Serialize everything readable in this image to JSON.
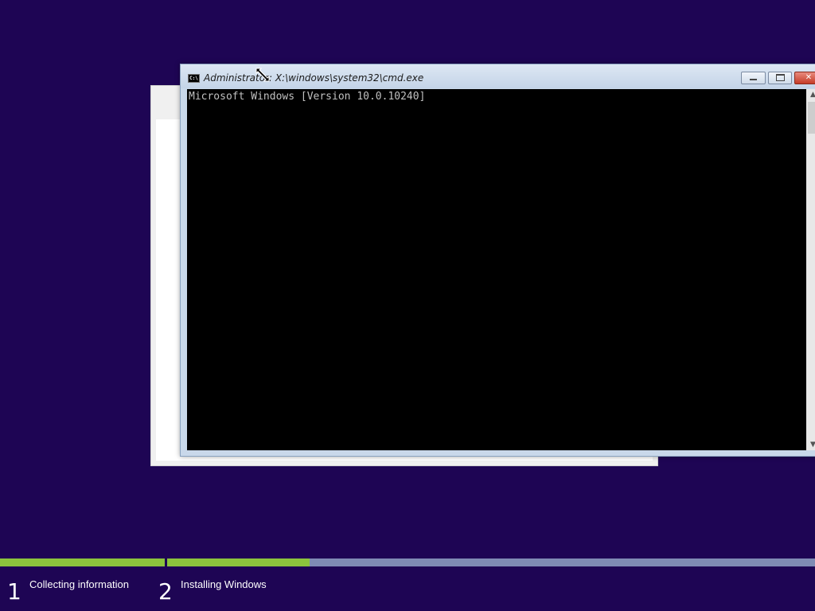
{
  "cmd_window": {
    "title": "Administrator: X:\\windows\\system32\\cmd.exe",
    "icon": "cmd-app-icon",
    "icon_text": "C:\\",
    "console_output": "Microsoft Windows [Version 10.0.10240]",
    "buttons": {
      "minimize": "minimize-icon",
      "maximize": "maximize-icon",
      "close": "close-icon",
      "close_glyph": "✕"
    },
    "scrollbar": {
      "up_glyph": "▲",
      "down_glyph": "▼"
    }
  },
  "setup": {
    "progress": {
      "step1_fraction": 1.0,
      "step2_fraction": 0.22
    },
    "steps": [
      {
        "number": "1",
        "label": "Collecting information"
      },
      {
        "number": "2",
        "label": "Installing Windows"
      }
    ]
  },
  "colors": {
    "background": "#1e0554",
    "progress_fill": "#8cc43d",
    "progress_track": "#7f8bb4",
    "console_bg": "#000000",
    "console_text": "#c0c0c0"
  }
}
